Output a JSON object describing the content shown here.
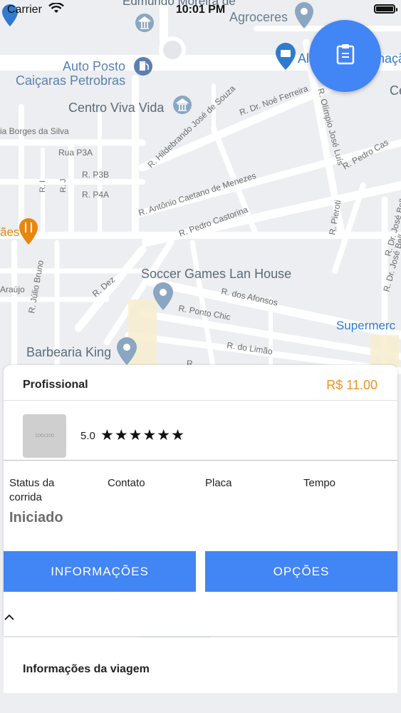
{
  "status_bar": {
    "carrier": "Carrier",
    "time": "10:01 PM"
  },
  "map": {
    "places": [
      "Edmundo Moreira de",
      "Agroceres",
      "Auto Posto",
      "Caiçaras Petrobras",
      "Centro Viva Vida",
      "Soccer Games Lan House",
      "Barbearia King",
      "Supermerc",
      "Al",
      "nação",
      "Ce",
      "ães"
    ],
    "streets": [
      "R. Dr. Noé Ferreira",
      "R. Hildebrando José de Souza",
      "R. Olímpio José Luís",
      "R. Antônio Caetano de Menezes",
      "R. Pedro Castorina",
      "R. Pedro Cas",
      "R. Pieroti",
      "R. Dr. José Bell",
      "ia Borges da Silva",
      "Rua P3A",
      "R. P3B",
      "R. P4A",
      "R. I",
      "R. J",
      "R. Júlio Bruno",
      "Araújo",
      "R. Dez",
      "R. dos Afonsos",
      "R. Ponto Chic",
      "R. do Limão",
      "R. Dr. José Bellu",
      "R"
    ]
  },
  "fab": {
    "icon": "clipboard-icon"
  },
  "ride": {
    "professional_label": "Profissional",
    "price": "R$ 11.00",
    "avatar_placeholder": "100x100",
    "rating": "5.0",
    "stars": "★★★★★★",
    "columns": [
      "Status da corrida",
      "Contato",
      "Placa",
      "Tempo"
    ],
    "status_value": "Iniciado",
    "info_button": "INFORMAÇÕES",
    "options_button": "OPÇÕES",
    "trip_info_title": "Informações da viagem"
  },
  "colors": {
    "accent": "#4285f4",
    "price": "#f39220",
    "poi": "#8aa6c1"
  }
}
